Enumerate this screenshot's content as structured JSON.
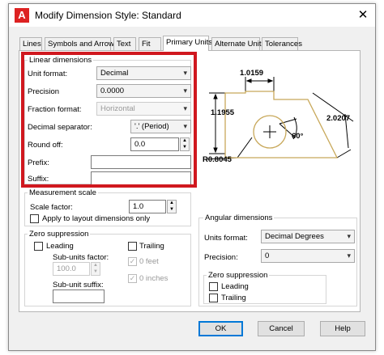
{
  "window": {
    "title": "Modify Dimension Style: Standard",
    "app_icon": "A",
    "close_glyph": "✕"
  },
  "tabs": [
    {
      "label": "Lines"
    },
    {
      "label": "Symbols and Arrows"
    },
    {
      "label": "Text"
    },
    {
      "label": "Fit"
    },
    {
      "label": "Primary Units",
      "active": true
    },
    {
      "label": "Alternate Units"
    },
    {
      "label": "Tolerances"
    }
  ],
  "linear": {
    "title": "Linear dimensions",
    "unit_format_label": "Unit format:",
    "unit_format_value": "Decimal",
    "precision_label": "Precision",
    "precision_value": "0.0000",
    "fraction_label": "Fraction format:",
    "fraction_value": "Horizontal",
    "decimal_sep_label": "Decimal separator:",
    "decimal_sep_value": "'.' (Period)",
    "round_off_label": "Round off:",
    "round_off_value": "0.0",
    "prefix_label": "Prefix:",
    "prefix_value": "",
    "suffix_label": "Suffix:",
    "suffix_value": ""
  },
  "measurement": {
    "title": "Measurement scale",
    "scale_label": "Scale factor:",
    "scale_value": "1.0",
    "apply_layout_label": "Apply to layout dimensions only"
  },
  "zero_linear": {
    "title": "Zero suppression",
    "leading_label": "Leading",
    "trailing_label": "Trailing",
    "subunits_factor_label": "Sub-units factor:",
    "subunits_factor_value": "100.0",
    "feet_label": "0 feet",
    "inches_label": "0 inches",
    "subunit_suffix_label": "Sub-unit suffix:",
    "subunit_suffix_value": ""
  },
  "preview": {
    "dim_top": "1.0159",
    "dim_left": "1.1955",
    "dim_right": "2.0207",
    "dim_angle": "60°",
    "dim_radius": "R0.8045"
  },
  "angular": {
    "title": "Angular dimensions",
    "units_format_label": "Units format:",
    "units_format_value": "Decimal Degrees",
    "precision_label": "Precision:",
    "precision_value": "0",
    "zero_title": "Zero suppression",
    "leading_label": "Leading",
    "trailing_label": "Trailing"
  },
  "buttons": {
    "ok": "OK",
    "cancel": "Cancel",
    "help": "Help"
  },
  "colors": {
    "highlight": "#d0181f",
    "preview_outline": "#c8a85a"
  }
}
